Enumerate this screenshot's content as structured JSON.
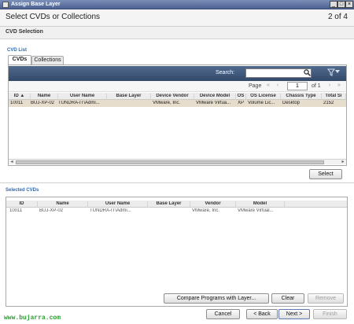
{
  "window": {
    "title": "Assign Base Layer",
    "minimize_glyph": "_",
    "maximize_glyph": "□",
    "close_glyph": "×"
  },
  "wizard": {
    "title": "Select CVDs or Collections",
    "step": "2 of 4",
    "section": "CVD Selection"
  },
  "cvd_list": {
    "label": "CVD List",
    "tabs": [
      {
        "label": "CVDs",
        "active": true
      },
      {
        "label": "Collections",
        "active": false
      }
    ],
    "search": {
      "label": "Search:",
      "value": "",
      "icon": "magnifier-icon",
      "filter_icon": "filter-icon"
    },
    "pager": {
      "label": "Page",
      "value": "1",
      "of_text": "of 1"
    },
    "columns": [
      "ID ▲",
      "Name",
      "User Name",
      "Base Layer",
      "Device Vendor",
      "Device Model",
      "OS",
      "OS License",
      "Chassis Type",
      "Total Si"
    ],
    "rows": [
      {
        "id": "10011",
        "name": "BUJ-XP-02",
        "user_name": "TUNDRA-IT\\Admi...",
        "base_layer": "",
        "device_vendor": "VMware, Inc.",
        "device_model": "VMware Virtua...",
        "os": "XP",
        "os_license": "Volume Lic...",
        "chassis_type": "Desktop",
        "total_size": "2152"
      }
    ],
    "select_button": "Select"
  },
  "selected_cvds": {
    "label": "Selected CVDs",
    "columns": [
      "ID",
      "Name",
      "User Name",
      "Base Layer",
      "Vendor",
      "Model"
    ],
    "rows": [
      {
        "id": "10011",
        "name": "BUJ-XP-02",
        "user_name": "TUNDRA-IT\\Admi...",
        "base_layer": "",
        "vendor": "VMware, Inc.",
        "model": "VMware Virtual..."
      }
    ],
    "buttons": {
      "compare": "Compare Programs with Layer...",
      "clear": "Clear",
      "remove": "Remove"
    }
  },
  "footer": {
    "cancel": "Cancel",
    "back": "< Back",
    "next": "Next >",
    "finish": "Finish"
  },
  "watermark": "www.bujarra.com"
}
